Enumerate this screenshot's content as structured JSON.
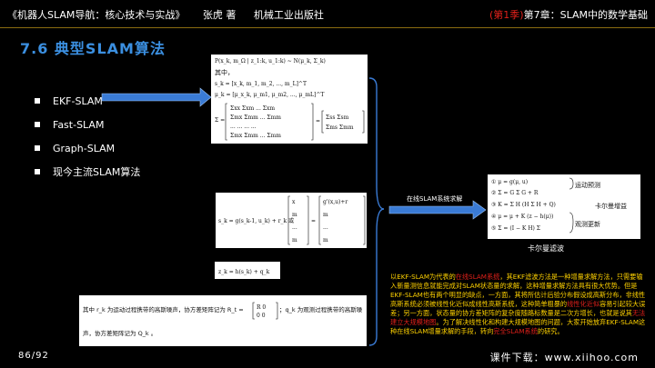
{
  "header": {
    "book_title": "《机器人SLAM导航：核心技术与实战》",
    "author": "张虎 著",
    "publisher": "机械工业出版社",
    "season": "(第1季)",
    "chapter": "第7章：SLAM中的数学基础"
  },
  "slide": {
    "title": "7.6 典型SLAM算法"
  },
  "bullets": [
    {
      "label": "EKF-SLAM"
    },
    {
      "label": "Fast-SLAM"
    },
    {
      "label": "Graph-SLAM"
    },
    {
      "label": "现今主流SLAM算法"
    }
  ],
  "equations": {
    "eq1_lines": [
      "P(x_k, m_Ω | z_1:k, u_1:k) ~ N(μ_k, Σ_k)",
      "其中，",
      "s_k = [x_k, m_1, m_2, ..., m_L]^T",
      "μ_k = [μ_x_k, μ_m1, μ_m2, ..., μ_mL]^T"
    ],
    "eq2": "s_k = g(s_k-1, u_k) + r_k 或",
    "eq3": "z_k = h(s_k) + q_k",
    "eq4_line1": "其中 r_k 为运动过程携带的高斯噪声，协方差矩阵记为 R_t =",
    "eq4_line1b": "；q_k 为观测过程携带的高斯噪",
    "eq4_line2": "声，协方差矩阵记为 Q_k 。",
    "kf_annotations": [
      "运动预测",
      "卡尔曼增益",
      "观测更新"
    ]
  },
  "arrow_label": "在线SLAM系统求解",
  "kf_label": "卡尔曼滤波",
  "description": {
    "p1": "以EKF-SLAM为代表的",
    "p1_red": "在线SLAM系统",
    "p2": "，其EKF滤波方法是一种增量求解方法，只需要输入新量测信息就能完成对SLAM状态量的求解，这种增量求解方法具有很大优势。但是EKF-SLAM也有两个明显的缺点，一方面，其将所估计后验分布假设成高斯分布，非线性高斯系统必须被线性化近似成线性高斯系统，这种简单粗暴的",
    "p2_red": "线性化近似",
    "p3": "容易引起较大误差；另一方面，状态量的协方差矩阵的复杂度随路标数量是二次方增长，也就是说其",
    "p3_red": "无法建立大规模地图",
    "p4": "。为了解决线性化和构建大规模地图的问题，大家开始放弃EKF-SLAM这种在线SLAM增量求解的手段，转向",
    "p4_red": "完全SLAM系统",
    "p5": "的研究。"
  },
  "page_number": "86/92",
  "footer": "课件下载：www.xiihoo.com",
  "colors": {
    "title_blue": "#3b8fe0",
    "accent_red": "#e0201a",
    "text_yellow": "#ffd200",
    "arrow_blue": "#3a7bd5"
  }
}
